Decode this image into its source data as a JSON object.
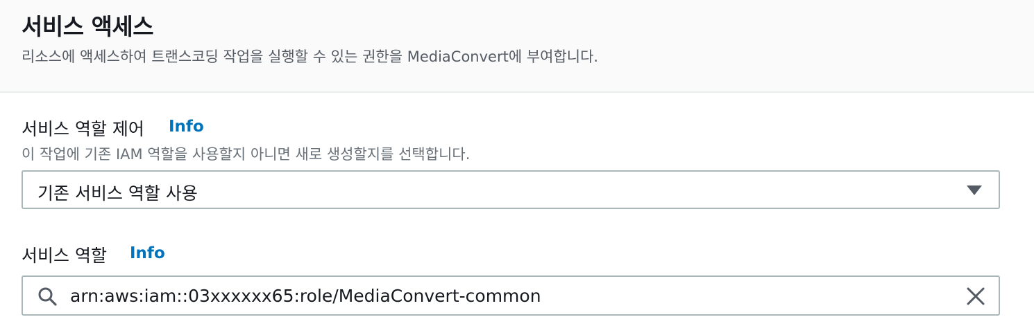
{
  "section": {
    "title": "서비스 액세스",
    "description": "리소스에 액세스하여 트랜스코딩 작업을 실행할 수 있는 권한을 MediaConvert에 부여합니다."
  },
  "role_control": {
    "label": "서비스 역할 제어",
    "info_label": "Info",
    "description": "이 작업에 기존 IAM 역할을 사용할지 아니면 새로 생성할지를 선택합니다.",
    "selected_value": "기존 서비스 역할 사용",
    "caret_icon": "caret-down-icon"
  },
  "service_role": {
    "label": "서비스 역할",
    "info_label": "Info",
    "value": "arn:aws:iam::03xxxxxx65:role/MediaConvert-common",
    "search_icon": "search-icon",
    "clear_icon": "close-icon"
  },
  "colors": {
    "link": "#0073bb",
    "border": "#aab7b8",
    "header_bg": "#fafafa",
    "text": "#16191f",
    "muted_text": "#687078"
  }
}
